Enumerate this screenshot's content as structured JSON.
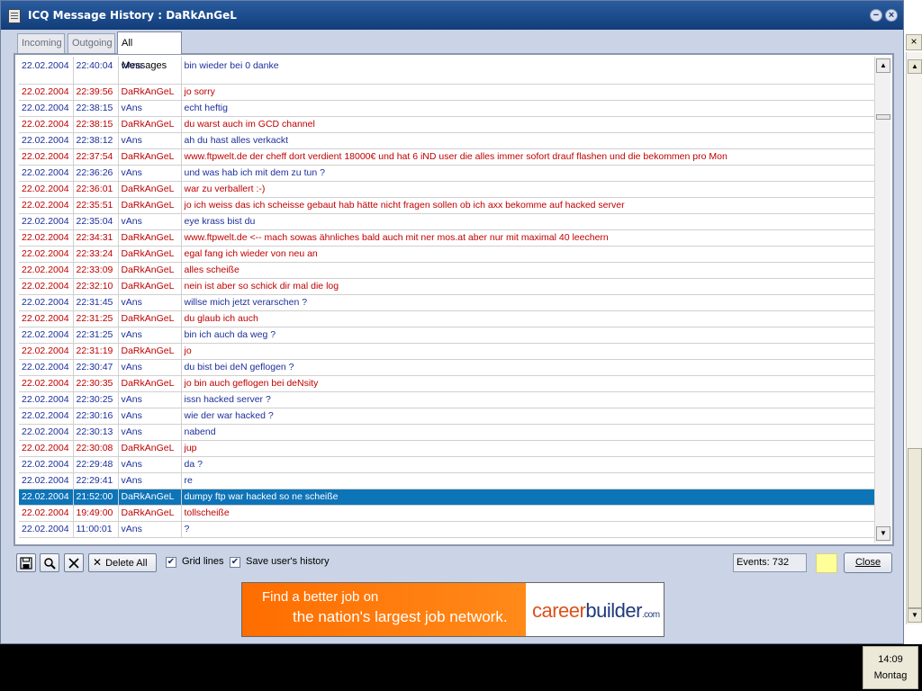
{
  "window": {
    "title": "ICQ Message History : DaRkAnGeL",
    "minimize_glyph": "−",
    "close_glyph": "×"
  },
  "tabs": [
    {
      "label": "Incoming",
      "active": false
    },
    {
      "label": "Outgoing",
      "active": false
    },
    {
      "label": "All Messages",
      "active": true
    }
  ],
  "messages": [
    {
      "date": "22.02.2004",
      "time": "22:40:04",
      "nick": "vAns",
      "text": "bin wieder bei 0 danke"
    },
    {
      "date": "22.02.2004",
      "time": "22:39:56",
      "nick": "DaRkAnGeL",
      "text": "jo sorry"
    },
    {
      "date": "22.02.2004",
      "time": "22:38:15",
      "nick": "vAns",
      "text": "echt heftig"
    },
    {
      "date": "22.02.2004",
      "time": "22:38:15",
      "nick": "DaRkAnGeL",
      "text": "du warst auch im GCD channel"
    },
    {
      "date": "22.02.2004",
      "time": "22:38:12",
      "nick": "vAns",
      "text": "ah du hast alles verkackt"
    },
    {
      "date": "22.02.2004",
      "time": "22:37:54",
      "nick": "DaRkAnGeL",
      "text": "www.ftpwelt.de der cheff dort verdient 18000€ und hat 6 iND user die alles immer sofort drauf flashen und die bekommen pro Mon"
    },
    {
      "date": "22.02.2004",
      "time": "22:36:26",
      "nick": "vAns",
      "text": "und was hab ich mit dem zu tun ?"
    },
    {
      "date": "22.02.2004",
      "time": "22:36:01",
      "nick": "DaRkAnGeL",
      "text": "war zu verballert :-)"
    },
    {
      "date": "22.02.2004",
      "time": "22:35:51",
      "nick": "DaRkAnGeL",
      "text": "jo ich weiss das ich scheisse gebaut hab hätte nicht fragen sollen ob ich axx bekomme auf hacked server"
    },
    {
      "date": "22.02.2004",
      "time": "22:35:04",
      "nick": "vAns",
      "text": "eye krass bist du"
    },
    {
      "date": "22.02.2004",
      "time": "22:34:31",
      "nick": "DaRkAnGeL",
      "text": "www.ftpwelt.de <-- mach sowas ähnliches bald auch mit ner mos.at aber nur mit maximal 40 leechern"
    },
    {
      "date": "22.02.2004",
      "time": "22:33:24",
      "nick": "DaRkAnGeL",
      "text": "egal fang ich wieder von neu an"
    },
    {
      "date": "22.02.2004",
      "time": "22:33:09",
      "nick": "DaRkAnGeL",
      "text": "alles scheiße"
    },
    {
      "date": "22.02.2004",
      "time": "22:32:10",
      "nick": "DaRkAnGeL",
      "text": "nein ist aber so schick dir mal die log"
    },
    {
      "date": "22.02.2004",
      "time": "22:31:45",
      "nick": "vAns",
      "text": "willse mich jetzt verarschen ?"
    },
    {
      "date": "22.02.2004",
      "time": "22:31:25",
      "nick": "DaRkAnGeL",
      "text": "du glaub ich auch"
    },
    {
      "date": "22.02.2004",
      "time": "22:31:25",
      "nick": "vAns",
      "text": "bin ich auch da weg ?"
    },
    {
      "date": "22.02.2004",
      "time": "22:31:19",
      "nick": "DaRkAnGeL",
      "text": "jo"
    },
    {
      "date": "22.02.2004",
      "time": "22:30:47",
      "nick": "vAns",
      "text": "du bist bei deN geflogen ?"
    },
    {
      "date": "22.02.2004",
      "time": "22:30:35",
      "nick": "DaRkAnGeL",
      "text": "jo bin auch geflogen bei deNsity"
    },
    {
      "date": "22.02.2004",
      "time": "22:30:25",
      "nick": "vAns",
      "text": "issn hacked server ?"
    },
    {
      "date": "22.02.2004",
      "time": "22:30:16",
      "nick": "vAns",
      "text": "wie der war hacked ?"
    },
    {
      "date": "22.02.2004",
      "time": "22:30:13",
      "nick": "vAns",
      "text": "nabend"
    },
    {
      "date": "22.02.2004",
      "time": "22:30:08",
      "nick": "DaRkAnGeL",
      "text": "jup"
    },
    {
      "date": "22.02.2004",
      "time": "22:29:48",
      "nick": "vAns",
      "text": "da ?"
    },
    {
      "date": "22.02.2004",
      "time": "22:29:41",
      "nick": "vAns",
      "text": "re"
    },
    {
      "date": "22.02.2004",
      "time": "21:52:00",
      "nick": "DaRkAnGeL",
      "text": "dumpy ftp war hacked so ne scheiße",
      "selected": true
    },
    {
      "date": "22.02.2004",
      "time": "19:49:00",
      "nick": "DaRkAnGeL",
      "text": "tollscheiße"
    },
    {
      "date": "22.02.2004",
      "time": "11:00:01",
      "nick": "vAns",
      "text": "?"
    }
  ],
  "toolbar": {
    "delete_all_label": "Delete All",
    "grid_lines_label": "Grid lines",
    "grid_lines_checked": true,
    "save_history_label": "Save user's history",
    "save_history_checked": true,
    "events_label": "Events: 732",
    "close_label": "Close"
  },
  "banner": {
    "line1": "Find a better job on",
    "line2": "the nation's largest job network.",
    "logo_career": "career",
    "logo_builder": "builder",
    "logo_com": ".com"
  },
  "clock": {
    "time": "14:09",
    "day": "Montag"
  },
  "colors": {
    "incoming_text": "#1c2f9c",
    "outgoing_text": "#c00000",
    "selection": "#0e74b8",
    "titlebar": "#1b4a8a",
    "banner_orange": "#ff6d00"
  }
}
